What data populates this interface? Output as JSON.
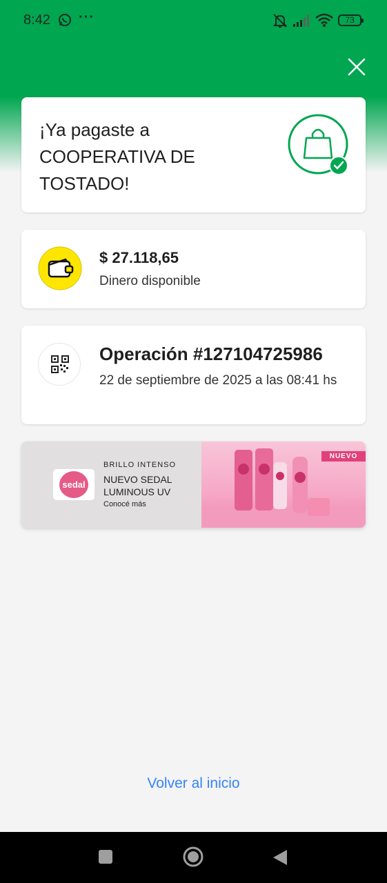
{
  "status_bar": {
    "time": "8:42",
    "more": "···",
    "battery": "73",
    "icons": [
      "whatsapp-icon",
      "mute-bell-icon",
      "signal-icon",
      "wifi-icon",
      "battery-icon"
    ]
  },
  "header": {
    "close_icon": "close-icon"
  },
  "success": {
    "title": "¡Ya pagaste a COOPERATIVA DE TOSTADO!",
    "icon": "shopping-bag-check-icon"
  },
  "balance": {
    "amount": "$ 27.118,65",
    "label": "Dinero disponible",
    "icon": "wallet-icon"
  },
  "operation": {
    "title": "Operación #127104725986",
    "date": "22 de septiembre de 2025 a las 08:41 hs",
    "icon": "qr-code-icon"
  },
  "banner": {
    "kicker": "BRILLO INTENSO",
    "title": "NUEVO SEDAL LUMINOUS UV",
    "cta": "Conocé más",
    "brand": "sedal",
    "tag": "NUEVO"
  },
  "footer": {
    "home_link": "Volver al inicio"
  },
  "colors": {
    "brand_green": "#00a650",
    "link_blue": "#3483fa",
    "wallet_yellow": "#ffe600",
    "background": "#f4f4f4"
  }
}
